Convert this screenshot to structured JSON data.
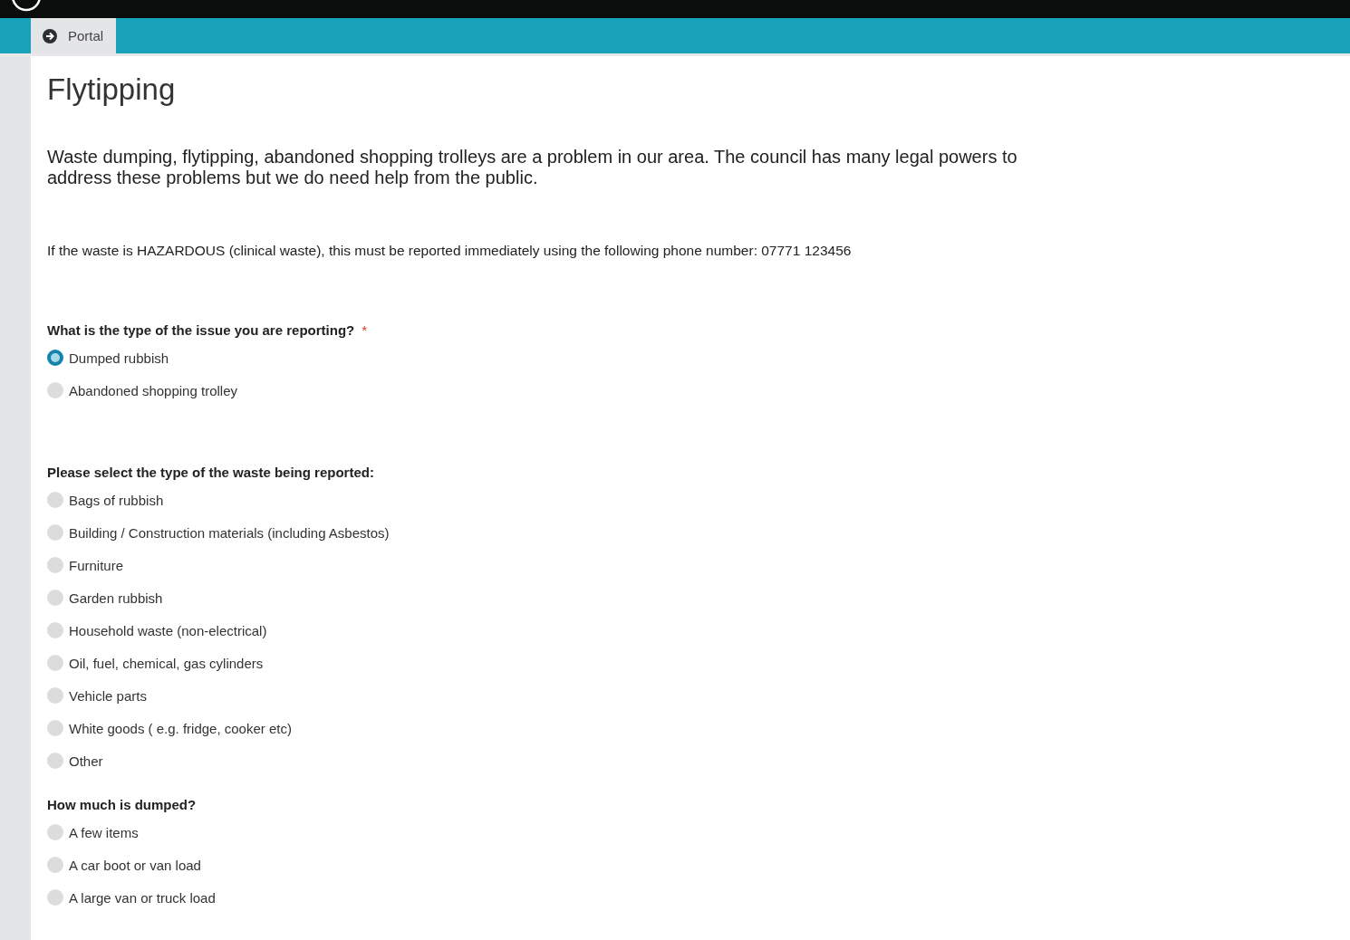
{
  "nav": {
    "tabs": [
      {
        "label": "Portal",
        "selected": true
      }
    ]
  },
  "page": {
    "title": "Flytipping",
    "intro": "Waste dumping, flytipping, abandoned shopping trolleys are a problem in our area. The council has many legal powers to address these problems but we do need help from the public.",
    "notice": "If the waste is HAZARDOUS (clinical waste), this must be reported immediately using the following phone number: 07771 123456"
  },
  "questions": [
    {
      "label": "What is the type of the issue you are reporting?",
      "required_mark": "*",
      "options": [
        {
          "label": "Dumped rubbish",
          "selected": true
        },
        {
          "label": "Abandoned shopping trolley",
          "selected": false
        }
      ]
    },
    {
      "label": "Please select the type of the waste being reported:",
      "options": [
        {
          "label": "Bags of rubbish",
          "selected": false
        },
        {
          "label": "Building / Construction materials (including Asbestos)",
          "selected": false
        },
        {
          "label": "Furniture",
          "selected": false
        },
        {
          "label": "Garden rubbish",
          "selected": false
        },
        {
          "label": "Household waste (non-electrical)",
          "selected": false
        },
        {
          "label": "Oil, fuel, chemical, gas cylinders",
          "selected": false
        },
        {
          "label": "Vehicle parts",
          "selected": false
        },
        {
          "label": "White goods ( e.g. fridge, cooker etc)",
          "selected": false
        },
        {
          "label": "Other",
          "selected": false
        }
      ]
    },
    {
      "label": "How much is dumped?",
      "options": [
        {
          "label": "A few items",
          "selected": false
        },
        {
          "label": "A car boot or van load",
          "selected": false
        },
        {
          "label": "A large van or truck load",
          "selected": false
        }
      ]
    }
  ]
}
